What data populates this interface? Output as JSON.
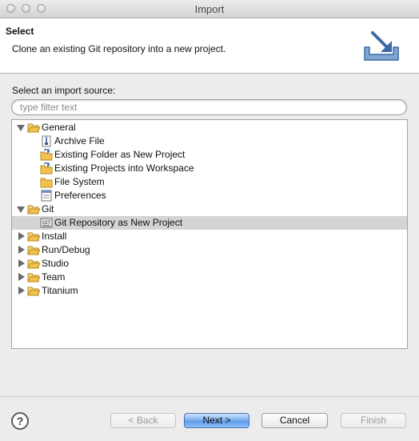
{
  "window": {
    "title": "Import"
  },
  "header": {
    "title": "Select",
    "description": "Clone an existing Git repository into a new project.",
    "icon": "import-wizard-icon"
  },
  "source": {
    "label": "Select an import source:",
    "filter_placeholder": "type filter text",
    "filter_value": ""
  },
  "tree": {
    "general": {
      "label": "General",
      "expanded": true,
      "children": [
        "Archive File",
        "Existing Folder as New Project",
        "Existing Projects into Workspace",
        "File System",
        "Preferences"
      ]
    },
    "git": {
      "label": "Git",
      "expanded": true,
      "children": [
        "Git Repository as New Project"
      ],
      "selected": "Git Repository as New Project"
    },
    "collapsed": [
      "Install",
      "Run/Debug",
      "Studio",
      "Team",
      "Titanium"
    ]
  },
  "buttons": {
    "help": "?",
    "back": "< Back",
    "next": "Next >",
    "cancel": "Cancel",
    "finish": "Finish"
  },
  "colors": {
    "selection": "#d4d4d4",
    "folder": "#f2c14e",
    "default_button": "#5a98ea"
  }
}
